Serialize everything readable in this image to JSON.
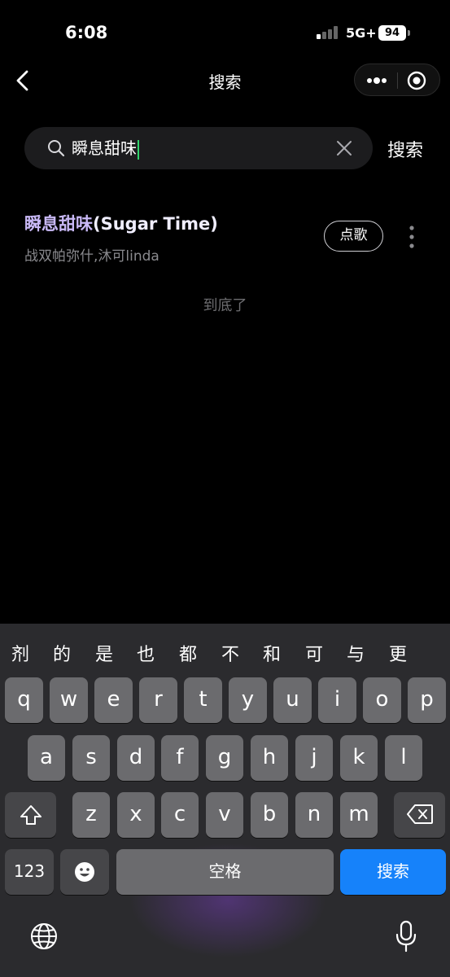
{
  "status_bar": {
    "time": "6:08",
    "network": "5G+",
    "battery": "94"
  },
  "nav": {
    "title": "搜索",
    "back_icon": "chevron-left-icon",
    "more_icon": "more-horizontal-icon",
    "target_icon": "target-icon"
  },
  "search": {
    "query": "瞬息甜味",
    "submit_label": "搜索"
  },
  "results": [
    {
      "title_highlight": "瞬息甜味",
      "title_rest": "(Sugar Time)",
      "artist": "战双帕弥什,沐可linda",
      "action_label": "点歌"
    }
  ],
  "end_text": "到底了",
  "keyboard": {
    "candidates": [
      "剂",
      "的",
      "是",
      "也",
      "都",
      "不",
      "和",
      "可",
      "与",
      "更"
    ],
    "row1": [
      "q",
      "w",
      "e",
      "r",
      "t",
      "y",
      "u",
      "i",
      "o",
      "p"
    ],
    "row2": [
      "a",
      "s",
      "d",
      "f",
      "g",
      "h",
      "j",
      "k",
      "l"
    ],
    "row3": [
      "z",
      "x",
      "c",
      "v",
      "b",
      "n",
      "m"
    ],
    "numbers_label": "123",
    "space_label": "空格",
    "return_label": "搜索",
    "colors": {
      "return_key": "#1682fa",
      "key": "#6b6b6e",
      "function_key": "#464649"
    }
  }
}
